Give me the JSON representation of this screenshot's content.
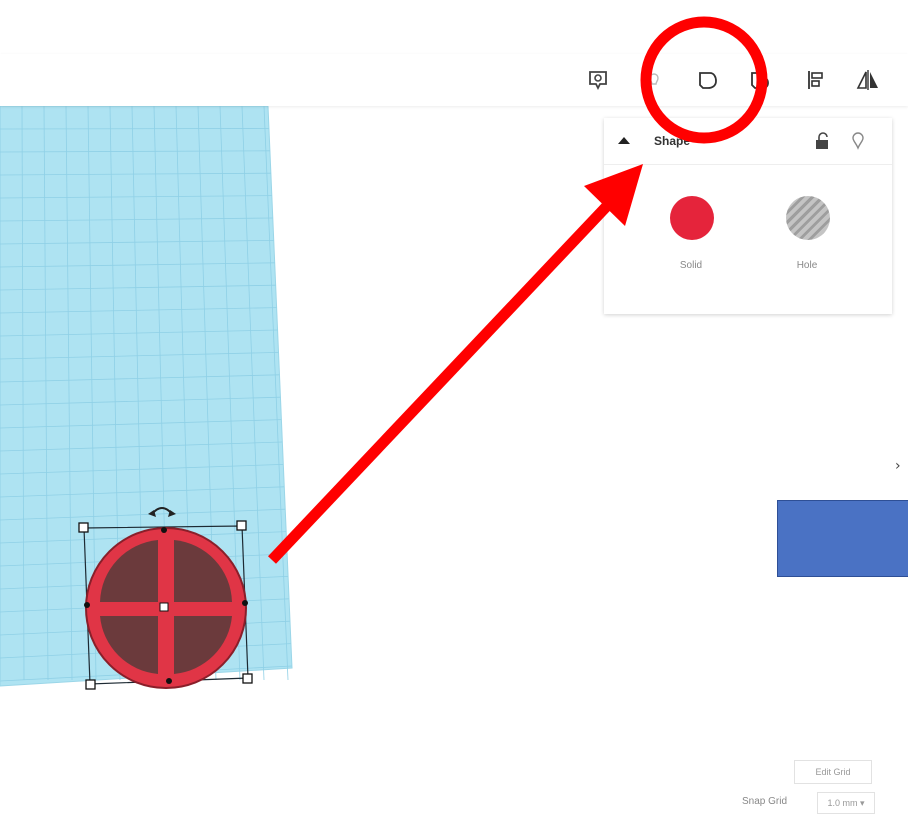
{
  "toolbar": {
    "tools": [
      {
        "name": "notes-tool",
        "icon": "note-eye-icon"
      },
      {
        "name": "show-all-tool",
        "icon": "lightbulb-icon"
      },
      {
        "name": "group-tool",
        "icon": "group-shape-icon"
      },
      {
        "name": "ungroup-tool",
        "icon": "ungroup-shape-icon"
      },
      {
        "name": "align-tool",
        "icon": "align-icon"
      },
      {
        "name": "mirror-tool",
        "icon": "mirror-icon"
      }
    ]
  },
  "shape_panel": {
    "title": "Shape",
    "solid_label": "Solid",
    "hole_label": "Hole",
    "solid_color": "#e5243b",
    "hole_color": "#bdbdbd"
  },
  "grid": {
    "edit_label": "Edit Grid",
    "snap_label": "Snap Grid",
    "snap_value": "1.0 mm ▾"
  },
  "side_toggle": "›",
  "annotation": {
    "circle_color": "#ff0000",
    "arrow_color": "#ff0000"
  },
  "workplane_color": "#aee3f2",
  "shape_color": "#e03546",
  "cutout_color": "#6b3a3c",
  "blue_shape_color": "#4a72c4"
}
